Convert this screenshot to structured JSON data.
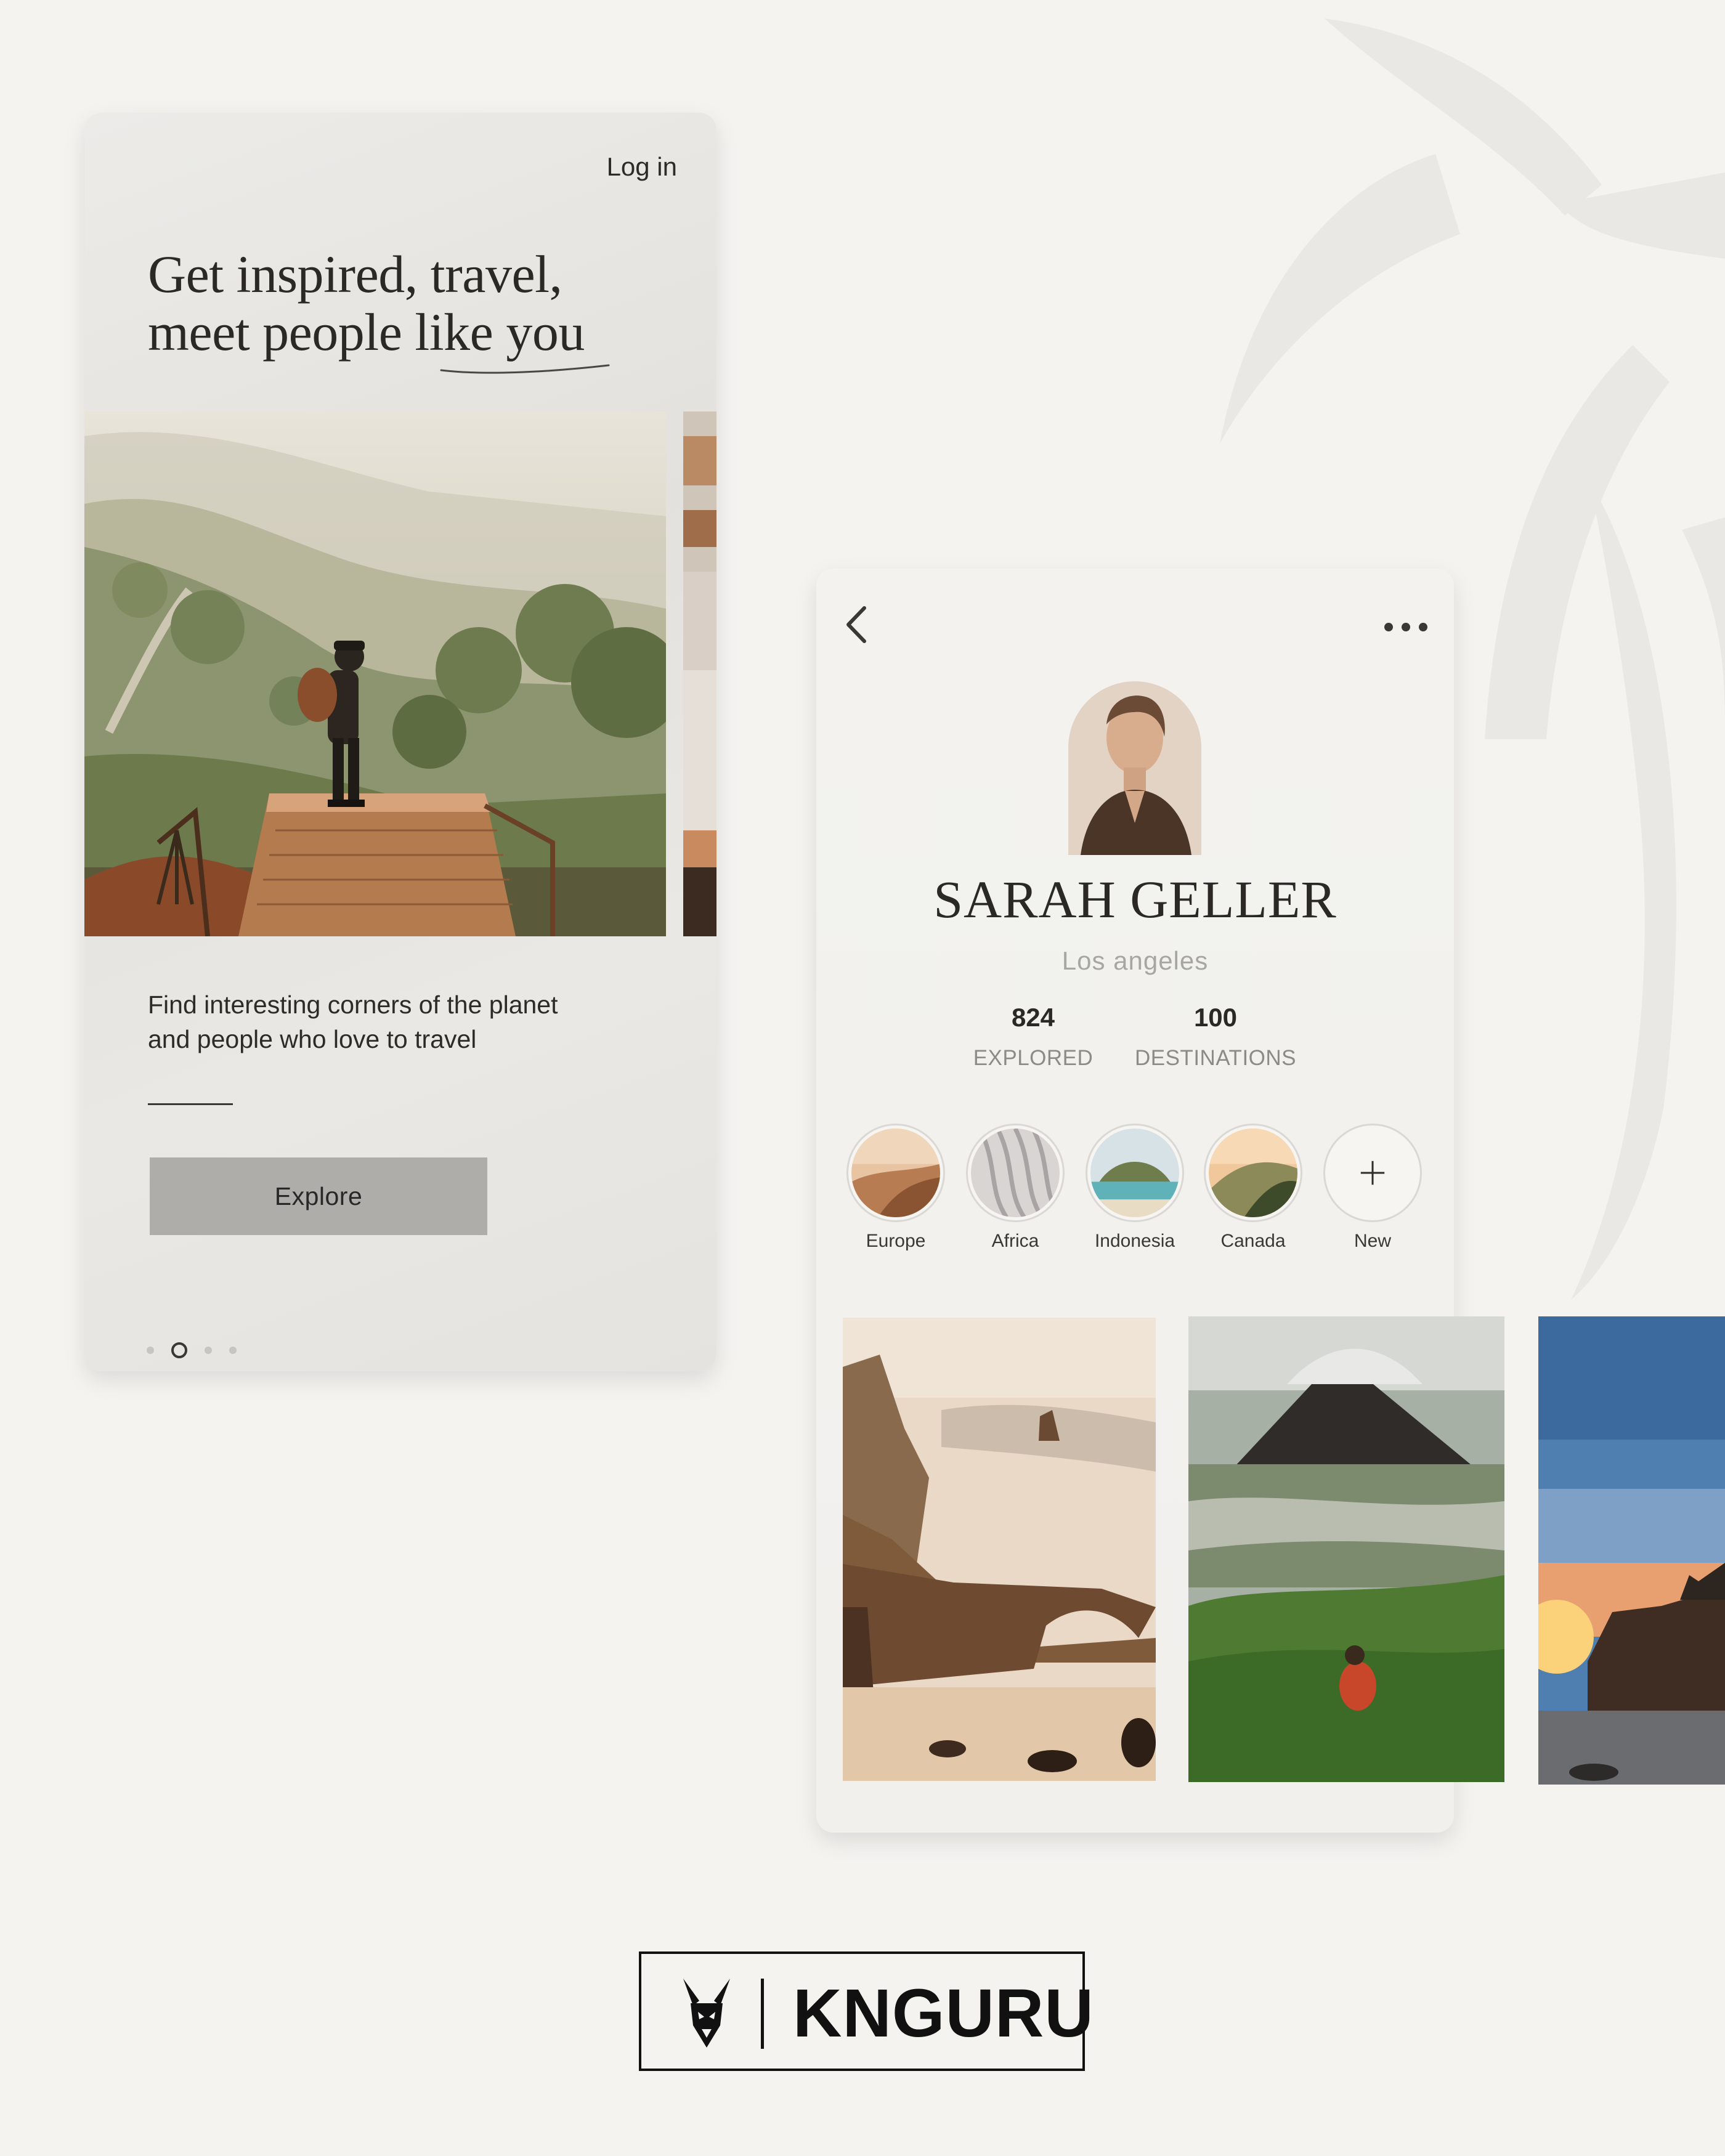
{
  "onboarding": {
    "login_label": "Log in",
    "headline_line1": "Get inspired, travel,",
    "headline_line2": "meet people like you",
    "tagline_line1": "Find interesting corners of the planet",
    "tagline_line2": "and people who love to travel",
    "explore_label": "Explore",
    "pagination": {
      "total": 4,
      "active_index": 1
    }
  },
  "profile": {
    "name": "SARAH GELLER",
    "city": "Los angeles",
    "stats": [
      {
        "value": "824",
        "label": "EXPLORED"
      },
      {
        "value": "100",
        "label": "DESTINATIONS"
      }
    ],
    "stories": [
      {
        "label": "Europe"
      },
      {
        "label": "Africa"
      },
      {
        "label": "Indonesia"
      },
      {
        "label": "Canada"
      },
      {
        "label": "New"
      }
    ]
  },
  "brand": {
    "name": "KNGURU"
  },
  "colors": {
    "background": "#f4f3f0",
    "button": "#aeadaa",
    "text": "#2b2926",
    "muted": "#a8a6a2"
  },
  "icons": [
    "back-chevron-icon",
    "more-dots-icon",
    "plus-icon",
    "kangaroo-logo-icon"
  ]
}
